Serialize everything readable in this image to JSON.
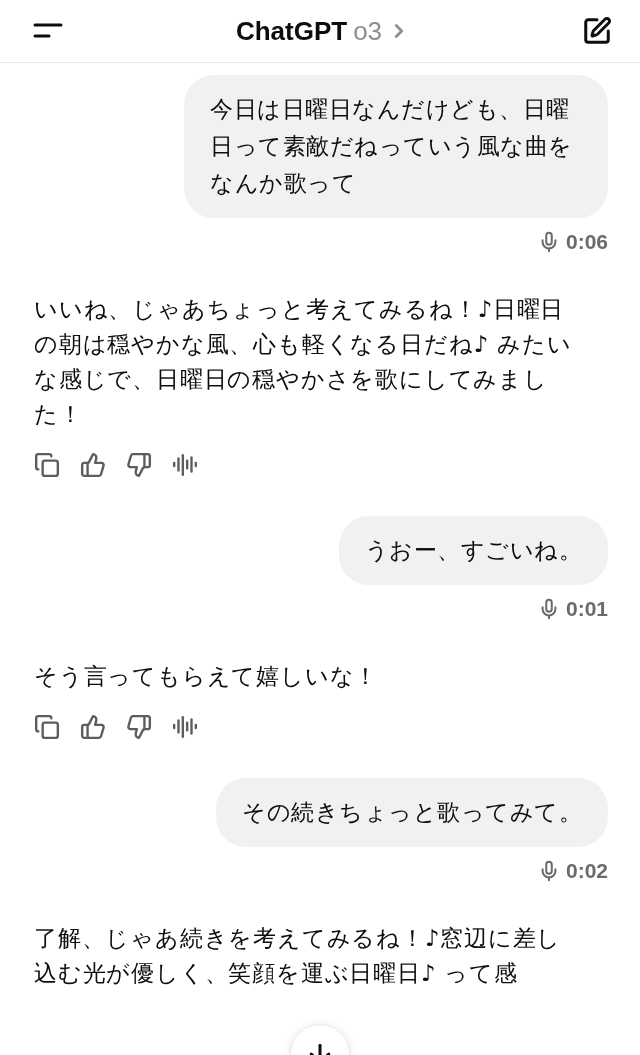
{
  "header": {
    "title": "ChatGPT",
    "model": "o3"
  },
  "messages": [
    {
      "kind": "user",
      "text": "今日は日曜日なんだけども、日曜日って素敵だねっていう風な曲をなんか歌って",
      "duration": "0:06"
    },
    {
      "kind": "assistant",
      "text": "いいね、じゃあちょっと考えてみるね！♪日曜日の朝は穏やかな風、心も軽くなる日だね♪ みたいな感じで、日曜日の穏やかさを歌にしてみました！"
    },
    {
      "kind": "user",
      "text": "うおー、すごいね。",
      "duration": "0:01"
    },
    {
      "kind": "assistant",
      "text": "そう言ってもらえて嬉しいな！"
    },
    {
      "kind": "user",
      "text": "その続きちょっと歌ってみて。",
      "duration": "0:02"
    },
    {
      "kind": "assistant_partial",
      "text": "了解、じゃあ続きを考えてみるね！♪窓辺に差し込む光が優しく、笑顔を運ぶ日曜日♪ って感"
    }
  ]
}
